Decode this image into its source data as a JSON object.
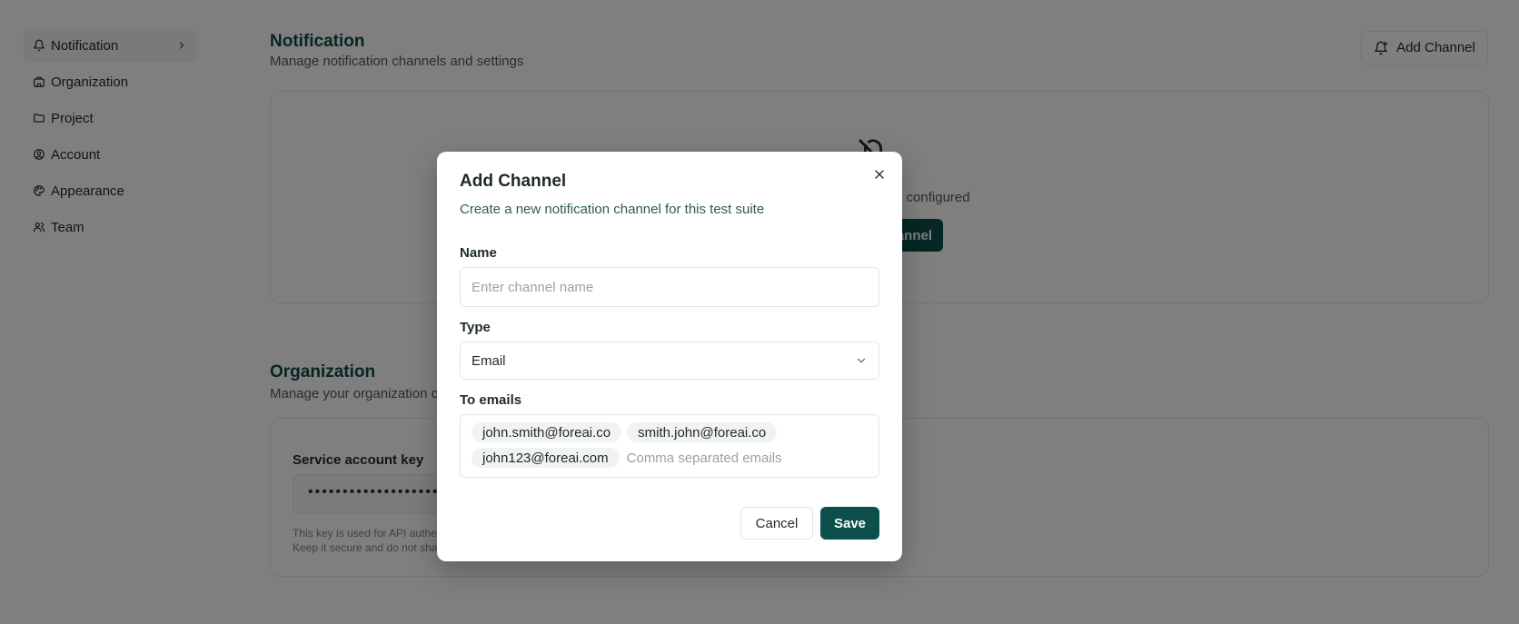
{
  "sidebar": {
    "items": [
      {
        "label": "Notification",
        "icon": "bell-icon",
        "active": true
      },
      {
        "label": "Organization",
        "icon": "building-icon"
      },
      {
        "label": "Project",
        "icon": "folder-icon"
      },
      {
        "label": "Account",
        "icon": "user-circle-icon"
      },
      {
        "label": "Appearance",
        "icon": "palette-icon"
      },
      {
        "label": "Team",
        "icon": "users-icon"
      }
    ]
  },
  "notification": {
    "title": "Notification",
    "subtitle": "Manage notification channels and settings",
    "add_button_label": "Add Channel",
    "empty_text": "No channels configured",
    "empty_button_label": "Add Channel"
  },
  "organization": {
    "title": "Organization",
    "subtitle": "Manage your organization configurations",
    "key_label": "Service account key",
    "key_value": "••••••••••••••••••••••••",
    "help_line1": "This key is used for API authentication.",
    "help_line2": "Keep it secure and do not share it."
  },
  "modal": {
    "title": "Add Channel",
    "subtitle": "Create a new notification channel for this test suite",
    "name_label": "Name",
    "name_placeholder": "Enter channel name",
    "name_value": "",
    "type_label": "Type",
    "type_value": "Email",
    "emails_label": "To emails",
    "emails": [
      "john.smith@foreai.co",
      "smith.john@foreai.co",
      "john123@foreai.com"
    ],
    "emails_placeholder": "Comma separated emails",
    "cancel_label": "Cancel",
    "save_label": "Save"
  },
  "colors": {
    "accent": "#0d4f4a",
    "heading": "#0e4a45",
    "overlay": "rgba(0,0,0,0.5)"
  }
}
